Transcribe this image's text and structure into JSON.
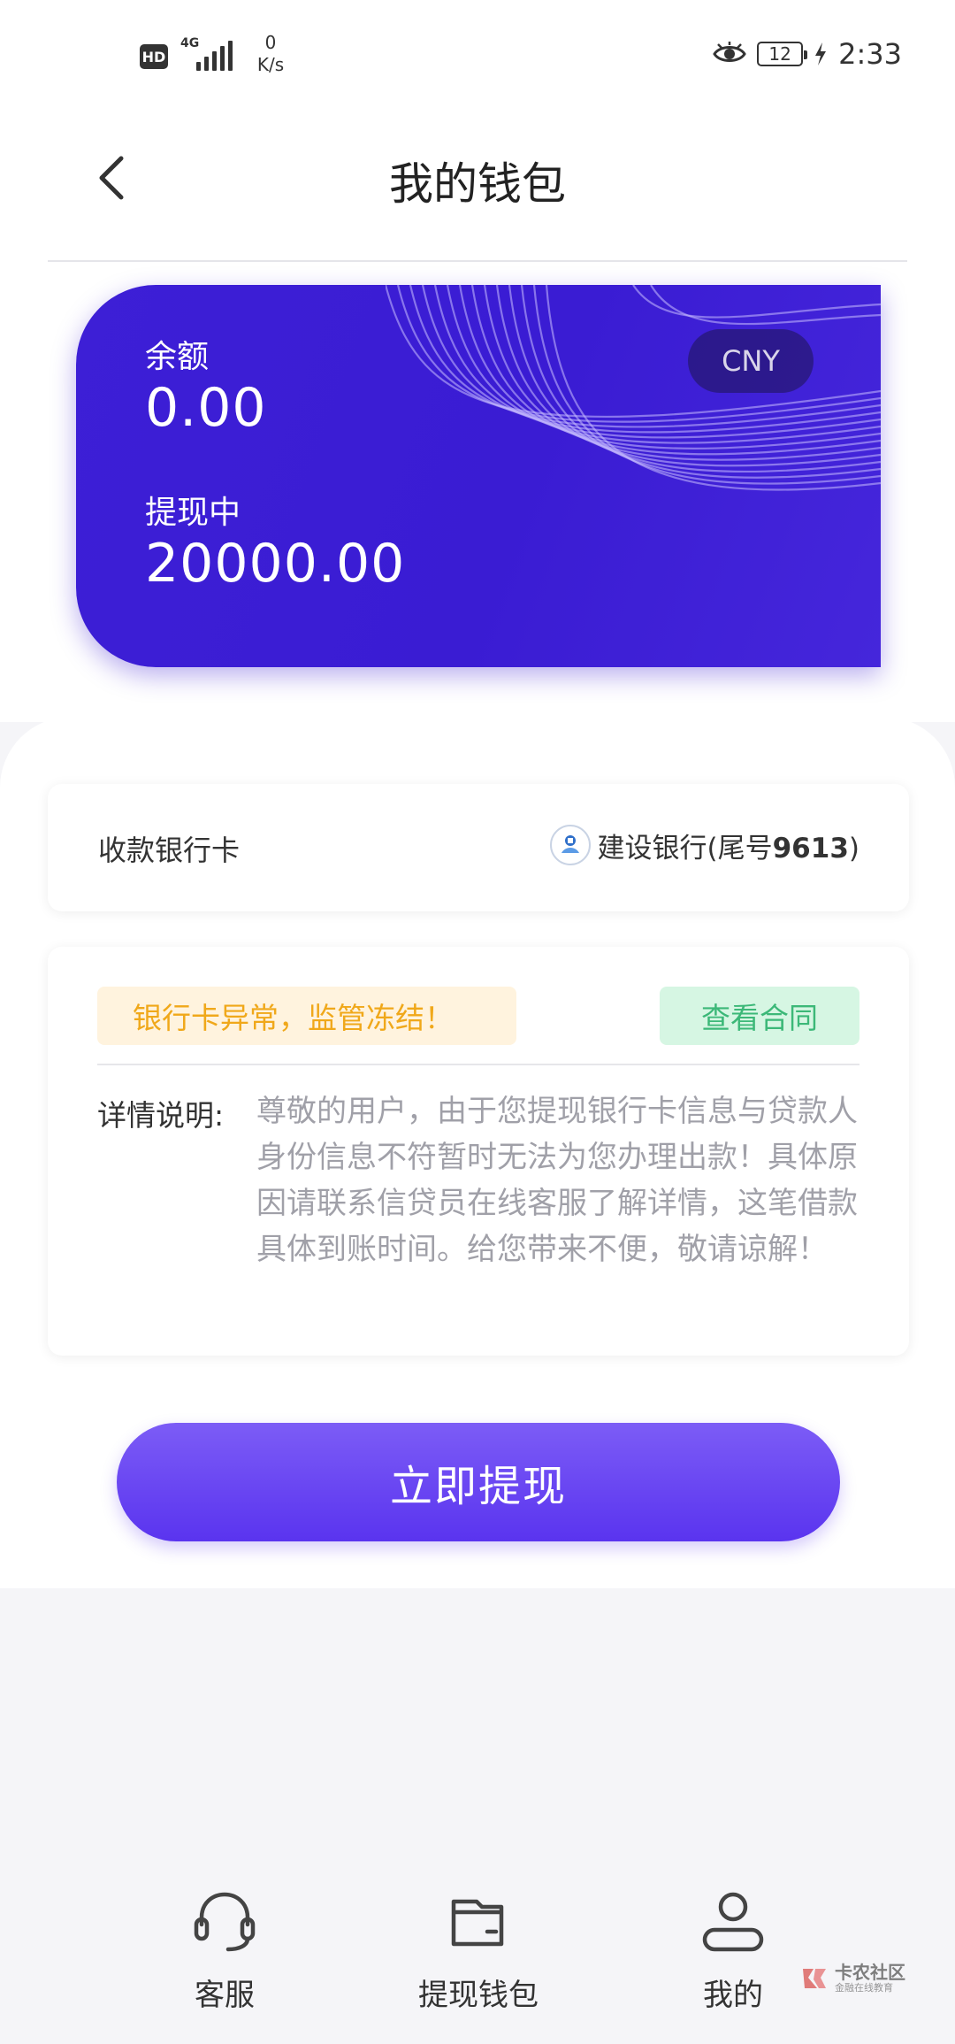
{
  "status_bar": {
    "hd": "HD",
    "network": "4G",
    "speed_value": "0",
    "speed_unit": "K/s",
    "battery": "12",
    "time": "2:33"
  },
  "header": {
    "title": "我的钱包"
  },
  "wallet_card": {
    "currency": "CNY",
    "balance_label": "余额",
    "balance_value": "0.00",
    "withdrawing_label": "提现中",
    "withdrawing_value": "20000.00"
  },
  "bank_card": {
    "label": "收款银行卡",
    "bank_name": "建设银行(尾号",
    "tail_number": "9613",
    "close_paren": ")"
  },
  "notice": {
    "warning": "银行卡异常，监管冻结！",
    "contract_button": "查看合同",
    "detail_label": "详情说明:",
    "detail_text": "尊敬的用户，由于您提现银行卡信息与贷款人身份信息不符暂时无法为您办理出款！具体原因请联系信贷员在线客服了解详情，这笔借款具体到账时间。给您带来不便，敬请谅解！"
  },
  "withdraw_button": "立即提现",
  "bottom_nav": {
    "items": [
      {
        "label": "客服",
        "icon": "headset-icon"
      },
      {
        "label": "提现钱包",
        "icon": "wallet-icon"
      },
      {
        "label": "我的",
        "icon": "user-icon"
      }
    ]
  },
  "watermark": {
    "title": "卡农社区",
    "subtitle": "金融在线教育"
  },
  "colors": {
    "card_background": "#3d1fd6",
    "button_gradient_top": "#7c5cf6",
    "button_gradient_bottom": "#5a34ef",
    "warning_text": "#f0a81a",
    "warning_background": "#fff3de",
    "contract_text": "#3cb878",
    "contract_background": "#d6f6e3"
  }
}
